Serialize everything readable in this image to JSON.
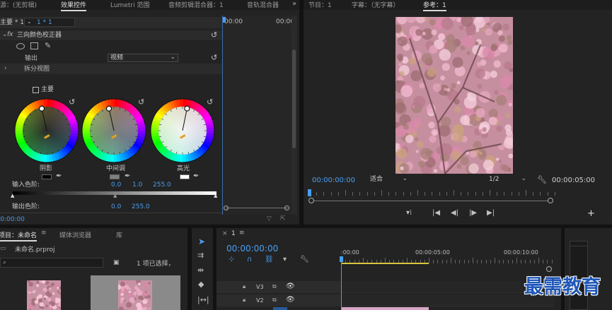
{
  "effect_controls": {
    "tabs": [
      "源：(无剪辑)",
      "效果控件",
      "Lumetri 范围",
      "音频剪辑混合器：1",
      "音轨混合器"
    ],
    "active_tab": 1,
    "master": "主要 * 1",
    "clip": "1 * 1",
    "effect_name": "三向颜色校正器",
    "output_label": "输出",
    "output_value": "视频",
    "split_view": "拆分视图",
    "master_checkbox": "主要",
    "wheels": [
      {
        "label": "阴影",
        "swatch": "#000000"
      },
      {
        "label": "中间调",
        "swatch": "#808080"
      },
      {
        "label": "高光",
        "swatch": "#ffffff"
      }
    ],
    "input_levels_label": "输入色阶:",
    "input_levels": [
      "0.0",
      "1.0",
      "255.0"
    ],
    "output_levels_label": "输出色阶:",
    "output_levels": [
      "0.0",
      "255.0"
    ],
    "time_start": "00:00",
    "time_end": "00:00",
    "timecode": "00:00:00:00"
  },
  "monitor": {
    "tabs": [
      "节目：1",
      "字幕：（无字幕）",
      "参考：1"
    ],
    "active_tab": 2,
    "timecode": "00:00:00:00",
    "fit": "适合",
    "quality": "1/2",
    "duration": "00:00:05:00"
  },
  "project": {
    "tabs": [
      "项目：未命名",
      "媒体浏览器",
      "库"
    ],
    "active_tab": 0,
    "file": "未命名.prproj",
    "selection": "1 项已选择，"
  },
  "timeline": {
    "sequence": "1",
    "timecode": "00:00:00:00",
    "ruler": [
      ":00:00",
      "00:00:05:00",
      "00:00:10:00"
    ],
    "tracks": [
      "V3",
      "V2"
    ]
  },
  "watermark": "最需教育"
}
